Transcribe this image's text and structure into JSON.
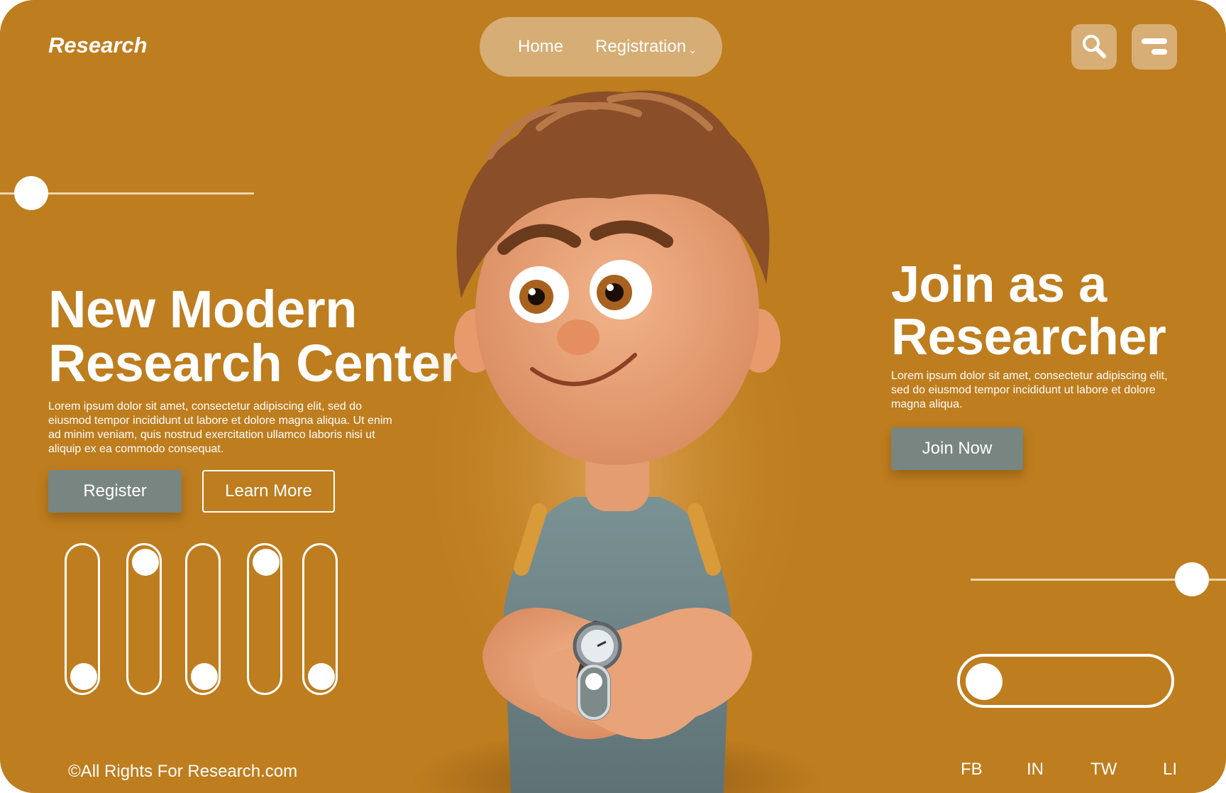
{
  "brand": {
    "name": "Research"
  },
  "nav": {
    "items": [
      {
        "label": "Home"
      },
      {
        "label": "Registration"
      }
    ],
    "search_icon": "search-icon",
    "menu_icon": "menu-icon"
  },
  "hero": {
    "title_line1": "New Modern",
    "title_line2": "Research Center",
    "text": "Lorem ipsum dolor sit amet, consectetur adipiscing elit, sed do eiusmod tempor incididunt ut labore et dolore magna aliqua. Ut enim ad minim veniam, quis nostrud exercitation ullamco laboris nisi ut aliquip ex ea commodo consequat.",
    "register_label": "Register",
    "learn_more_label": "Learn More"
  },
  "toggles": {
    "vertical_positions": [
      1,
      0,
      1,
      0,
      1
    ],
    "horizontal_position": 0,
    "left_slider_value": 0.1,
    "right_slider_value": 0.85
  },
  "join": {
    "title_line1": "Join as a",
    "title_line2": "Researcher",
    "text": "Lorem ipsum dolor sit amet, consectetur adipiscing elit, sed do eiusmod tempor incididunt ut labore et dolore magna aliqua.",
    "button_label": "Join Now"
  },
  "footer": {
    "copyright": "©All Rights For Research.com",
    "social": [
      "FB",
      "IN",
      "TW",
      "LI"
    ]
  },
  "colors": {
    "background": "#be7d1e",
    "nav_pill": "#d6ad74",
    "button_fill": "#798580",
    "text": "#ffffff"
  }
}
